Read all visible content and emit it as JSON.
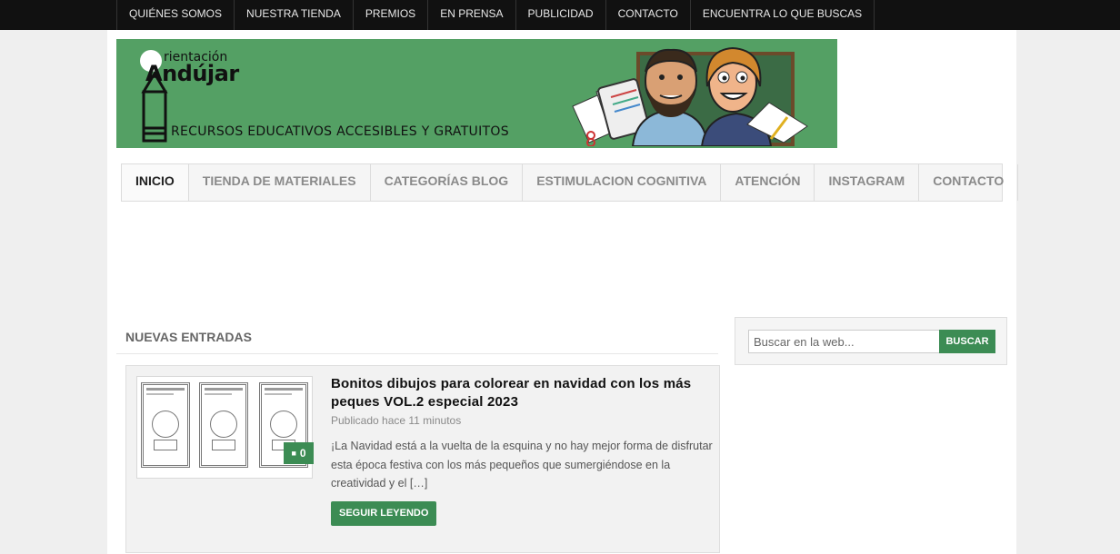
{
  "topnav": {
    "items": [
      "QUIÉNES SOMOS",
      "NUESTRA TIENDA",
      "PREMIOS",
      "EN PRENSA",
      "PUBLICIDAD",
      "CONTACTO",
      "ENCUENTRA LO QUE BUSCAS"
    ]
  },
  "banner": {
    "logo_small": "rientación",
    "logo_big": "Andújar",
    "tagline": "RECURSOS EDUCATIVOS ACCESIBLES Y GRATUITOS",
    "background_color": "#54a064"
  },
  "mainnav": {
    "items": [
      "INICIO",
      "TIENDA DE MATERIALES",
      "CATEGORÍAS BLOG",
      "ESTIMULACION COGNITIVA",
      "ATENCIÓN",
      "INSTAGRAM",
      "CONTACTO"
    ],
    "active": "INICIO"
  },
  "section": {
    "title": "NUEVAS ENTRADAS"
  },
  "post": {
    "title": "Bonitos dibujos para colorear en navidad con los más peques VOL.2 especial 2023",
    "meta": "Publicado hace 11 minutos",
    "excerpt": "¡La Navidad está a la vuelta de la esquina y no hay mejor forma de disfrutar esta época festiva con los más pequeños que sumergiéndose en la creatividad y el […]",
    "comment_count": "0",
    "read_more_label": "SEGUIR LEYENDO"
  },
  "sidebar": {
    "search_placeholder": "Buscar en la web...",
    "search_button": "BUSCAR"
  },
  "colors": {
    "accent": "#3c8c54",
    "topbar": "#111111"
  }
}
